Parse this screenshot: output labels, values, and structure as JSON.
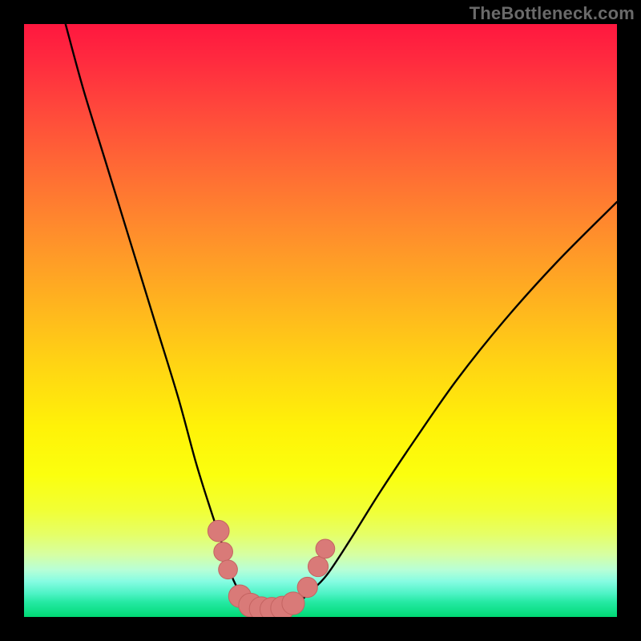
{
  "watermark": "TheBottleneck.com",
  "colors": {
    "frame": "#000000",
    "curve": "#000000",
    "marker_fill": "#d97a78",
    "marker_stroke": "#c46361",
    "gradient_top": "#ff173f",
    "gradient_bottom": "#00d873"
  },
  "chart_data": {
    "type": "line",
    "title": "",
    "xlabel": "",
    "ylabel": "",
    "xlim": [
      0,
      100
    ],
    "ylim": [
      0,
      100
    ],
    "grid": false,
    "note": "No numeric axes or tick labels are rendered; values estimated from pixel geometry (0–100 normalized).",
    "series": [
      {
        "name": "bottleneck-curve",
        "x": [
          7,
          10,
          14,
          18,
          22,
          26,
          29,
          31.5,
          33.5,
          35,
          36.5,
          38,
          40,
          42,
          44,
          46,
          48,
          51,
          55,
          60,
          66,
          73,
          81,
          90,
          100
        ],
        "y": [
          100,
          89,
          76,
          63,
          50,
          37,
          26,
          18,
          12,
          7,
          4,
          2.3,
          1.5,
          1.3,
          1.5,
          2.2,
          4,
          7,
          13,
          21,
          30,
          40,
          50,
          60,
          70
        ]
      }
    ],
    "markers": [
      {
        "x": 32.8,
        "y": 14.5,
        "r": 1.8
      },
      {
        "x": 33.6,
        "y": 11.0,
        "r": 1.6
      },
      {
        "x": 34.4,
        "y": 8.0,
        "r": 1.6
      },
      {
        "x": 36.4,
        "y": 3.5,
        "r": 1.9
      },
      {
        "x": 38.2,
        "y": 2.0,
        "r": 2.0
      },
      {
        "x": 40.0,
        "y": 1.4,
        "r": 2.0
      },
      {
        "x": 41.8,
        "y": 1.3,
        "r": 2.0
      },
      {
        "x": 43.6,
        "y": 1.5,
        "r": 2.0
      },
      {
        "x": 45.4,
        "y": 2.3,
        "r": 1.9
      },
      {
        "x": 47.8,
        "y": 5.0,
        "r": 1.7
      },
      {
        "x": 49.6,
        "y": 8.5,
        "r": 1.7
      },
      {
        "x": 50.8,
        "y": 11.5,
        "r": 1.6
      }
    ]
  }
}
